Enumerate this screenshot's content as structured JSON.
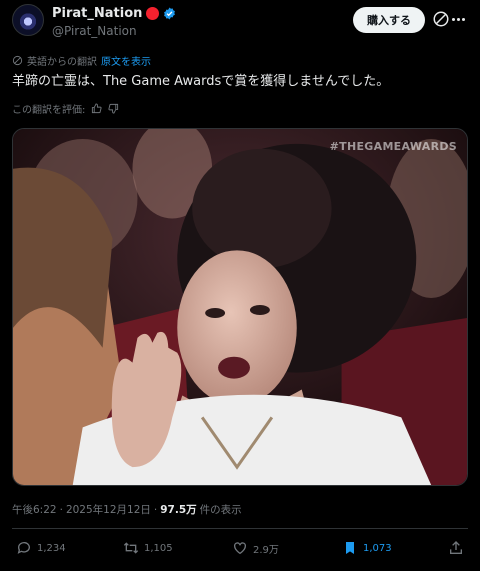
{
  "author": {
    "display_name": "Pirat_Nation",
    "handle": "@Pirat_Nation",
    "badge_color": "#f4212e",
    "verified_color": "#1d9bf0"
  },
  "header": {
    "buy_label": "購入する"
  },
  "translation": {
    "note": "英語からの翻訳",
    "show_original": "原文を表示",
    "rate_prompt": "この翻訳を評価:"
  },
  "tweet": {
    "text": "羊蹄の亡霊は、The Game Awardsで賞を獲得しませんでした。",
    "media_watermark": "#THEGAMEAWARDS"
  },
  "meta": {
    "time": "午後6:22",
    "sep1": "·",
    "date": "2025年12月12日",
    "sep2": "·",
    "views": "97.5万",
    "views_suffix": "件の表示"
  },
  "actions": {
    "replies": "1,234",
    "retweets": "1,105",
    "likes": "2.9万",
    "bookmarks": "1,073"
  },
  "colors": {
    "accent": "#1d9bf0",
    "background": "#000000",
    "muted": "#71767b"
  }
}
